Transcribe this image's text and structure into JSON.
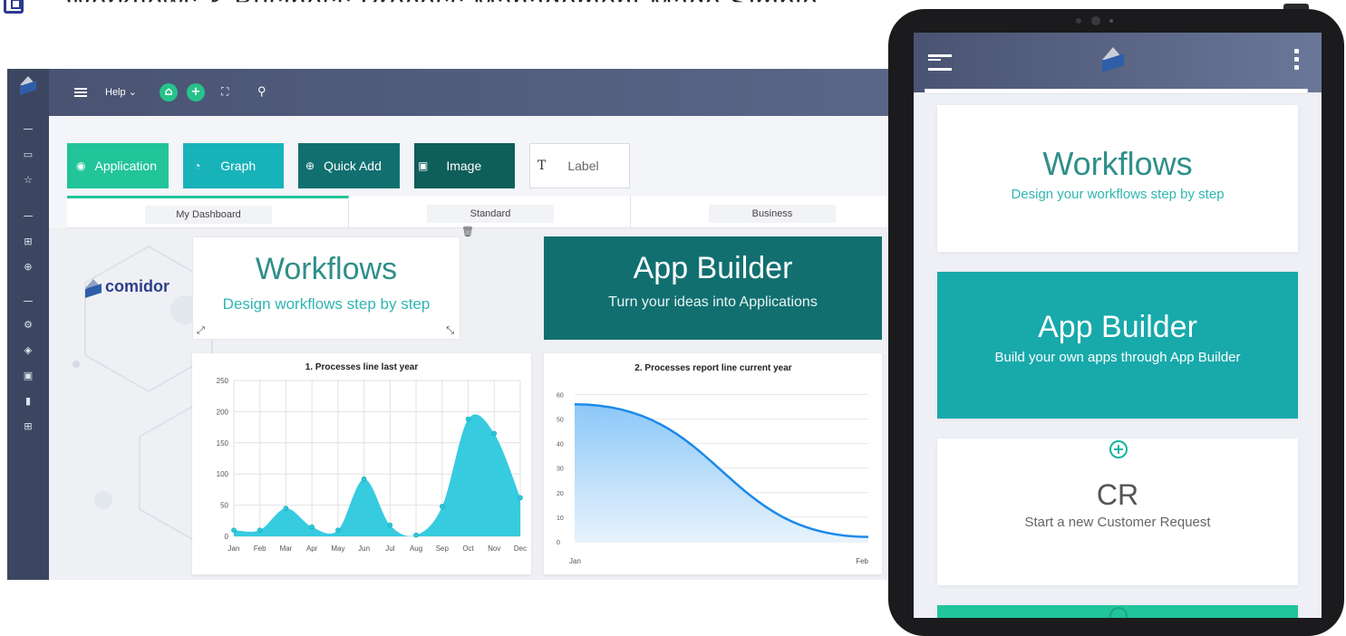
{
  "page_title_fragment": "Workflows & Business Process Management Made Simple",
  "colors": {
    "header": "#4a5372",
    "sidebar": "#3d4660",
    "green_btn": "#22c49a",
    "teal_btn": "#17b3b9",
    "dark_teal": "#126f70",
    "darker_teal": "#0e5e5a",
    "chart1_fill": "#2cc8dd",
    "chart2_line": "#1c89ea",
    "tablet_teal": "#18a9ab"
  },
  "desktop": {
    "header": {
      "menu_icon": "hamburger-icon",
      "help_label": "Help",
      "home_icon": "home-icon",
      "add_icon": "plus-icon",
      "fullscreen_icon": "expand-icon",
      "search_icon": "search-icon"
    },
    "sidebar_icons": [
      "folder-icon",
      "star-icon",
      "grid-icon",
      "plus-circle-icon",
      "gear-icon",
      "cube-icon",
      "briefcase-icon",
      "bar-chart-icon",
      "apps-icon"
    ],
    "toolbar": [
      {
        "label": "Application",
        "icon": "stack-icon"
      },
      {
        "label": "Graph",
        "icon": "pie-icon"
      },
      {
        "label": "Quick Add",
        "icon": "plus-circle-icon"
      },
      {
        "label": "Image",
        "icon": "image-icon"
      },
      {
        "label": "Label",
        "icon": "text-icon"
      }
    ],
    "tabs": [
      "My Dashboard",
      "Standard",
      "Business"
    ],
    "brand": "comidor",
    "workflows_widget": {
      "title": "Workflows",
      "subtitle": "Design workflows step by step"
    },
    "appbuilder_widget": {
      "title": "App Builder",
      "subtitle": "Turn your ideas into Applications"
    }
  },
  "chart_data": [
    {
      "type": "area",
      "title": "1. Processes line last year",
      "categories": [
        "Jan",
        "Feb",
        "Mar",
        "Apr",
        "May",
        "Jun",
        "Jul",
        "Aug",
        "Sep",
        "Oct",
        "Nov",
        "Dec"
      ],
      "values": [
        10,
        10,
        45,
        15,
        10,
        92,
        18,
        2,
        48,
        188,
        165,
        62
      ],
      "yticks": [
        "0",
        "50",
        "100",
        "150",
        "200",
        "250"
      ],
      "ylim": [
        0,
        250
      ],
      "grid": true
    },
    {
      "type": "area",
      "title": "2. Processes report line current year",
      "categories": [
        "Jan",
        "Feb"
      ],
      "yticks": [
        "0",
        "10",
        "20",
        "30",
        "40",
        "50",
        "60"
      ],
      "ylim": [
        0,
        62
      ],
      "values_start": 56,
      "values_end": 2,
      "grid": true
    }
  ],
  "tablet": {
    "menu_icon": "hamburger-icon",
    "more_icon": "kebab-icon",
    "cards": [
      {
        "title": "Workflows",
        "subtitle": "Design your workflows step by step"
      },
      {
        "title": "App Builder",
        "subtitle": "Build your own apps through App Builder"
      },
      {
        "title": "CR",
        "subtitle": "Start a new Customer Request",
        "icon": "plus-circle-icon"
      }
    ]
  }
}
